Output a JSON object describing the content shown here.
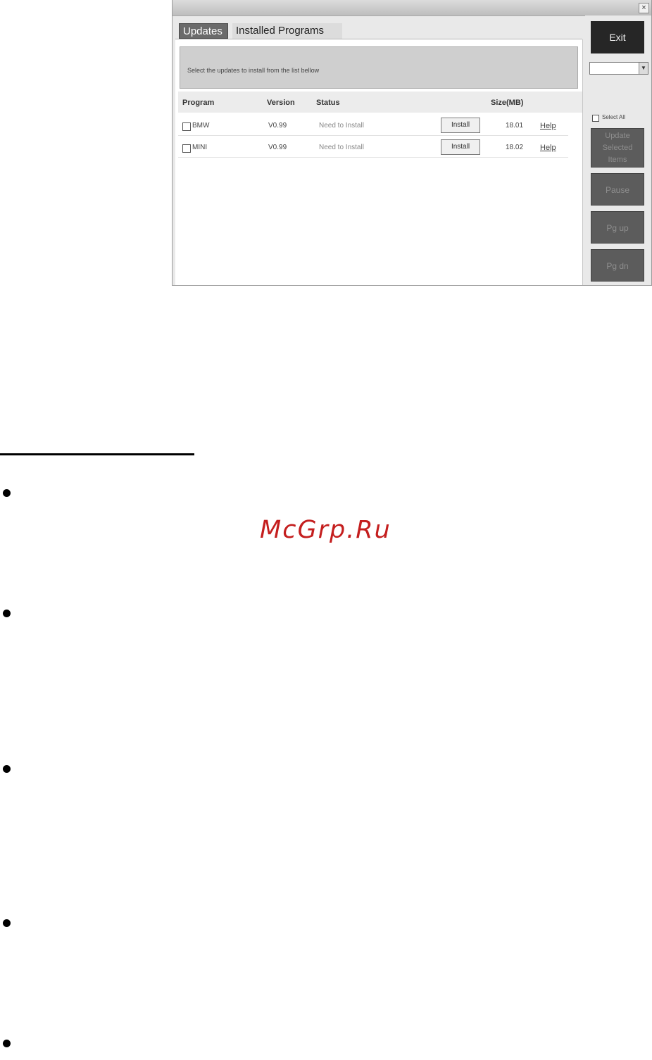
{
  "window": {
    "close_symbol": "×",
    "tabs": [
      {
        "label": "Updates",
        "active": true
      },
      {
        "label": "Installed Programs",
        "active": false
      }
    ],
    "message": "Select the updates to install from the list bellow",
    "columns": [
      "Program",
      "Version",
      "Status",
      "Size(MB)"
    ],
    "rows": [
      {
        "program": "BMW",
        "version": "V0.99",
        "status": "Need to Install",
        "install_label": "Install",
        "size": "18.01",
        "help_label": "Help"
      },
      {
        "program": "MINI",
        "version": "V0.99",
        "status": "Need to Install",
        "install_label": "Install",
        "size": "18.02",
        "help_label": "Help"
      }
    ],
    "sidebar": {
      "exit_label": "Exit",
      "dropdown_value": "",
      "dropdown_arrow": "▼",
      "select_all_label": "Select All",
      "update_selected_label": "Update\nSelected\nItems",
      "pause_label": "Pause",
      "pgup_label": "Pg up",
      "pgdn_label": "Pg dn"
    }
  },
  "watermark": "McGrp.Ru"
}
